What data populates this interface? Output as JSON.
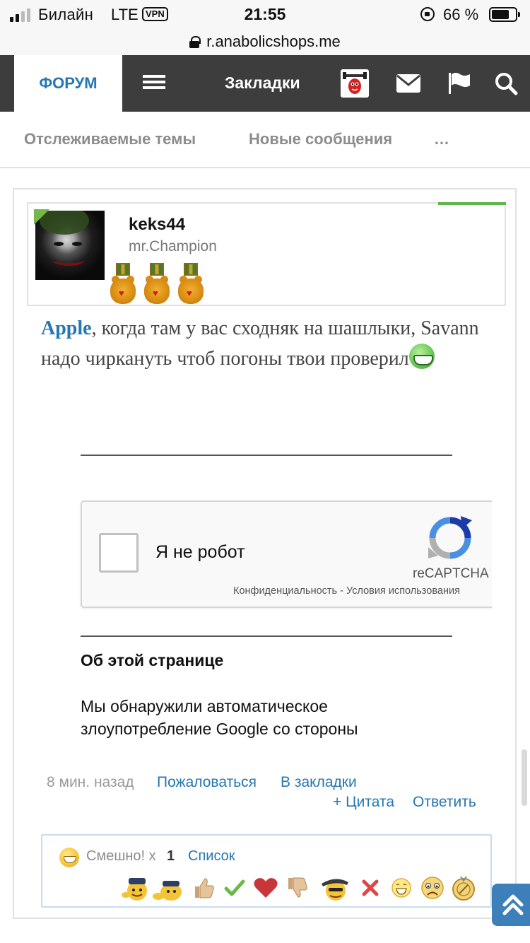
{
  "status_bar": {
    "carrier": "Билайн",
    "network": "LTE",
    "vpn": "VPN",
    "time": "21:55",
    "battery": "66 %"
  },
  "browser": {
    "url": "r.anabolicshops.me"
  },
  "nav": {
    "forum_tab": "ФОРУМ",
    "bookmarks": "Закладки",
    "icons": [
      "menu-icon",
      "user-avatar",
      "envelope-icon",
      "flag-icon",
      "search-icon"
    ]
  },
  "subnav": {
    "watched": "Отслеживаемые темы",
    "new_posts": "Новые сообщения",
    "more": "…"
  },
  "post": {
    "author": {
      "username": "keks44",
      "title": "mr.Champion",
      "medal_count": 3
    },
    "message": {
      "mention": "Apple",
      "text_1": ", когда там у вас сходняк на шашлыки, Savann надо чиркануть чтоб погоны твои проверил",
      "smiley": "grin-icon"
    },
    "embed": {
      "captcha_label": "Я не робот",
      "captcha_brand": "reCAPTCHA",
      "captcha_privacy": "Конфиденциальность",
      "captcha_sep": " - ",
      "captcha_terms": "Условия использования",
      "about_title": "Об этой странице",
      "about_text": "Мы обнаружили автоматическое злоупотребление Google со стороны"
    },
    "footer": {
      "time": "8 мин. назад",
      "report": "Пожаловаться",
      "bookmark": "В закладки",
      "quote": "+ Цитата",
      "reply": "Ответить"
    },
    "reactions": {
      "label": "Смешно!",
      "multiplier": "x",
      "count": "1",
      "list": "Список",
      "icons": [
        "cop-smile-icon",
        "cop-lying-icon",
        "thumbs-up-icon",
        "check-icon",
        "heart-icon",
        "thumbs-down-icon",
        "gangster-smile-icon",
        "cross-icon",
        "laugh-icon",
        "sad-icon",
        "badge-icon"
      ]
    }
  },
  "colors": {
    "accent": "#2577b1",
    "nav_bg": "#3d3d3d",
    "online": "#76b847"
  }
}
